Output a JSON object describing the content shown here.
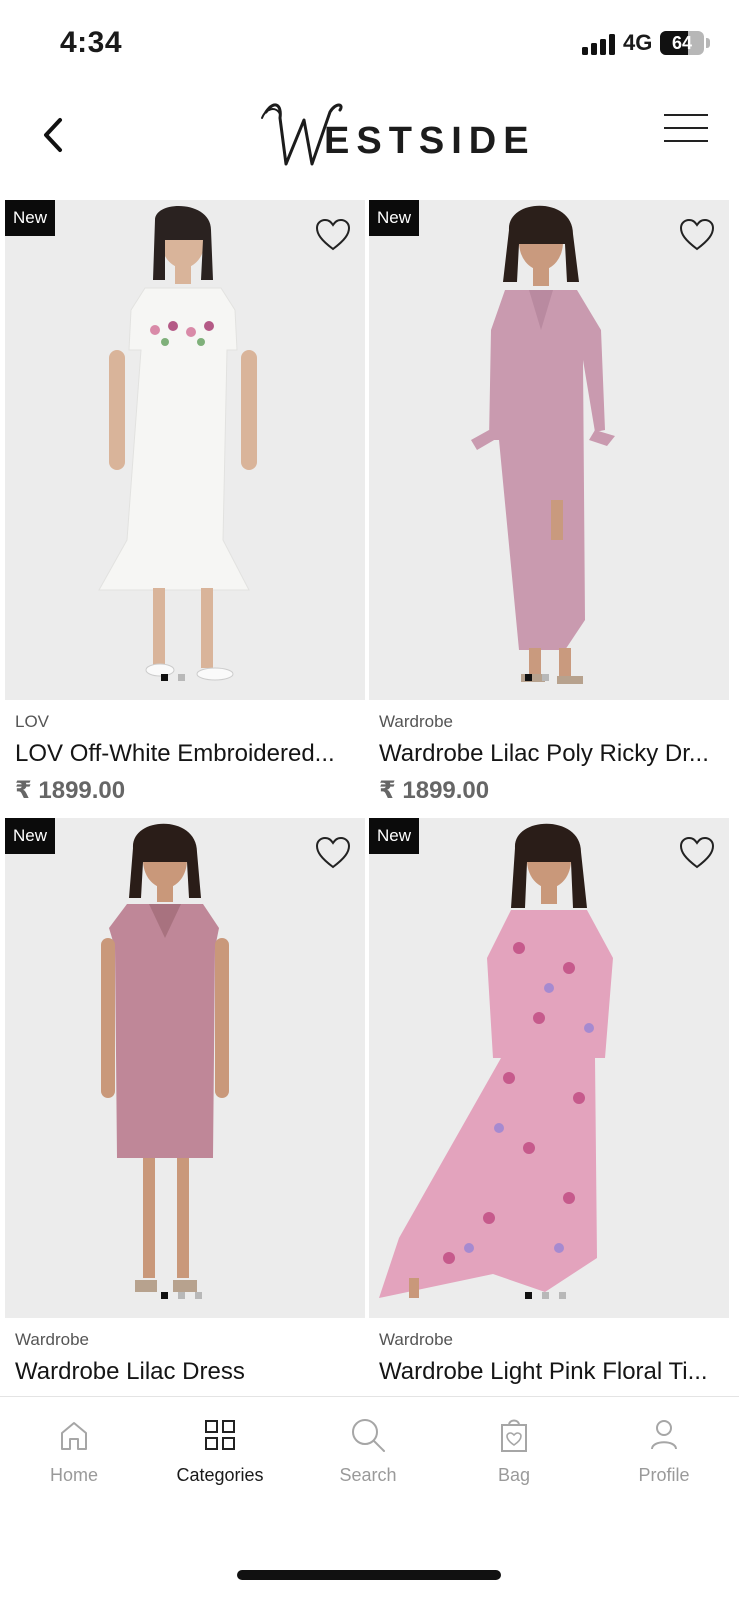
{
  "status": {
    "time": "4:34",
    "network": "4G",
    "battery": "64",
    "battery_level": 0.64
  },
  "header": {
    "brand_logo": "WESTSIDE",
    "logo_initial": "W"
  },
  "products": [
    {
      "badge": "New",
      "brand": "LOV",
      "title": "LOV Off-White Embroidered...",
      "price": "₹ 1899.00"
    },
    {
      "badge": "New",
      "brand": "Wardrobe",
      "title": "Wardrobe Lilac Poly Ricky Dr...",
      "price": "₹ 1899.00"
    },
    {
      "badge": "New",
      "brand": "Wardrobe",
      "title": "Wardrobe Lilac Dress",
      "price": ""
    },
    {
      "badge": "New",
      "brand": "Wardrobe",
      "title": "Wardrobe Light Pink Floral Ti...",
      "price": ""
    }
  ],
  "nav": {
    "items": [
      {
        "label": "Home",
        "icon": "home-icon"
      },
      {
        "label": "Categories",
        "icon": "grid-icon"
      },
      {
        "label": "Search",
        "icon": "search-icon"
      },
      {
        "label": "Bag",
        "icon": "bag-icon"
      },
      {
        "label": "Profile",
        "icon": "profile-icon"
      }
    ],
    "active": "Categories"
  },
  "colors": {
    "accent": "#111111",
    "muted": "#9a9a9a",
    "badge_bg": "#0b0b0b",
    "image_bg": "#ececec"
  }
}
